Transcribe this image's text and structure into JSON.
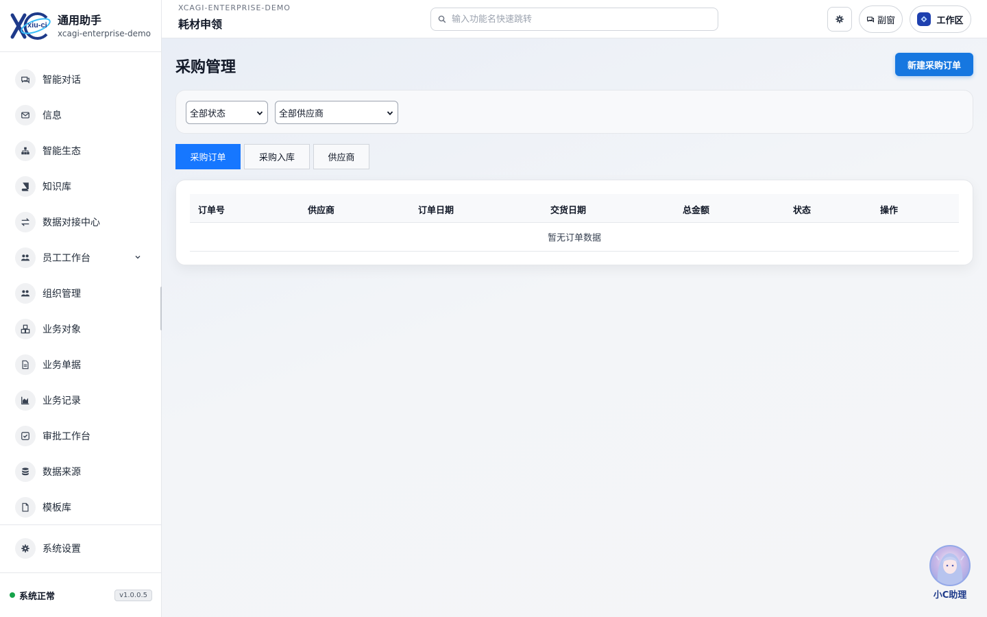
{
  "brand": {
    "title": "通用助手",
    "subtitle": "xcagi-enterprise-demo",
    "logo_text": "xiu-ci"
  },
  "sidebar": {
    "items": [
      {
        "label": "智能对话",
        "icon": "chat-icon"
      },
      {
        "label": "信息",
        "icon": "mail-icon"
      },
      {
        "label": "智能生态",
        "icon": "sitemap-icon"
      },
      {
        "label": "知识库",
        "icon": "book-icon"
      },
      {
        "label": "数据对接中心",
        "icon": "exchange-icon"
      },
      {
        "label": "员工工作台",
        "icon": "users-icon",
        "expandable": true
      },
      {
        "label": "组织管理",
        "icon": "users-icon"
      },
      {
        "label": "业务对象",
        "icon": "cubes-icon"
      },
      {
        "label": "业务单据",
        "icon": "document-icon"
      },
      {
        "label": "业务记录",
        "icon": "chart-area-icon"
      },
      {
        "label": "审批工作台",
        "icon": "check-square-icon"
      },
      {
        "label": "数据来源",
        "icon": "database-icon"
      },
      {
        "label": "模板库",
        "icon": "file-icon"
      }
    ],
    "settings_label": "系统设置",
    "status_text": "系统正常",
    "version": "v1.0.0.5",
    "status_color": "#16a34a"
  },
  "topbar": {
    "kicker": "XCAGI-ENTERPRISE-DEMO",
    "title": "耗材申领",
    "search_placeholder": "输入功能名快速跳转",
    "sub_window_label": "副窗",
    "workspace_label": "工作区"
  },
  "page": {
    "title": "采购管理",
    "new_button": "新建采购订单",
    "accent": "#1677e0",
    "filters": {
      "status": "全部状态",
      "supplier": "全部供应商"
    },
    "tabs": [
      {
        "label": "采购订单",
        "active": true
      },
      {
        "label": "采购入库",
        "active": false
      },
      {
        "label": "供应商",
        "active": false
      }
    ],
    "table": {
      "columns": [
        "订单号",
        "供应商",
        "订单日期",
        "交货日期",
        "总金额",
        "状态",
        "操作"
      ],
      "empty_text": "暂无订单数据"
    }
  },
  "assistant": {
    "label": "小C助理"
  }
}
